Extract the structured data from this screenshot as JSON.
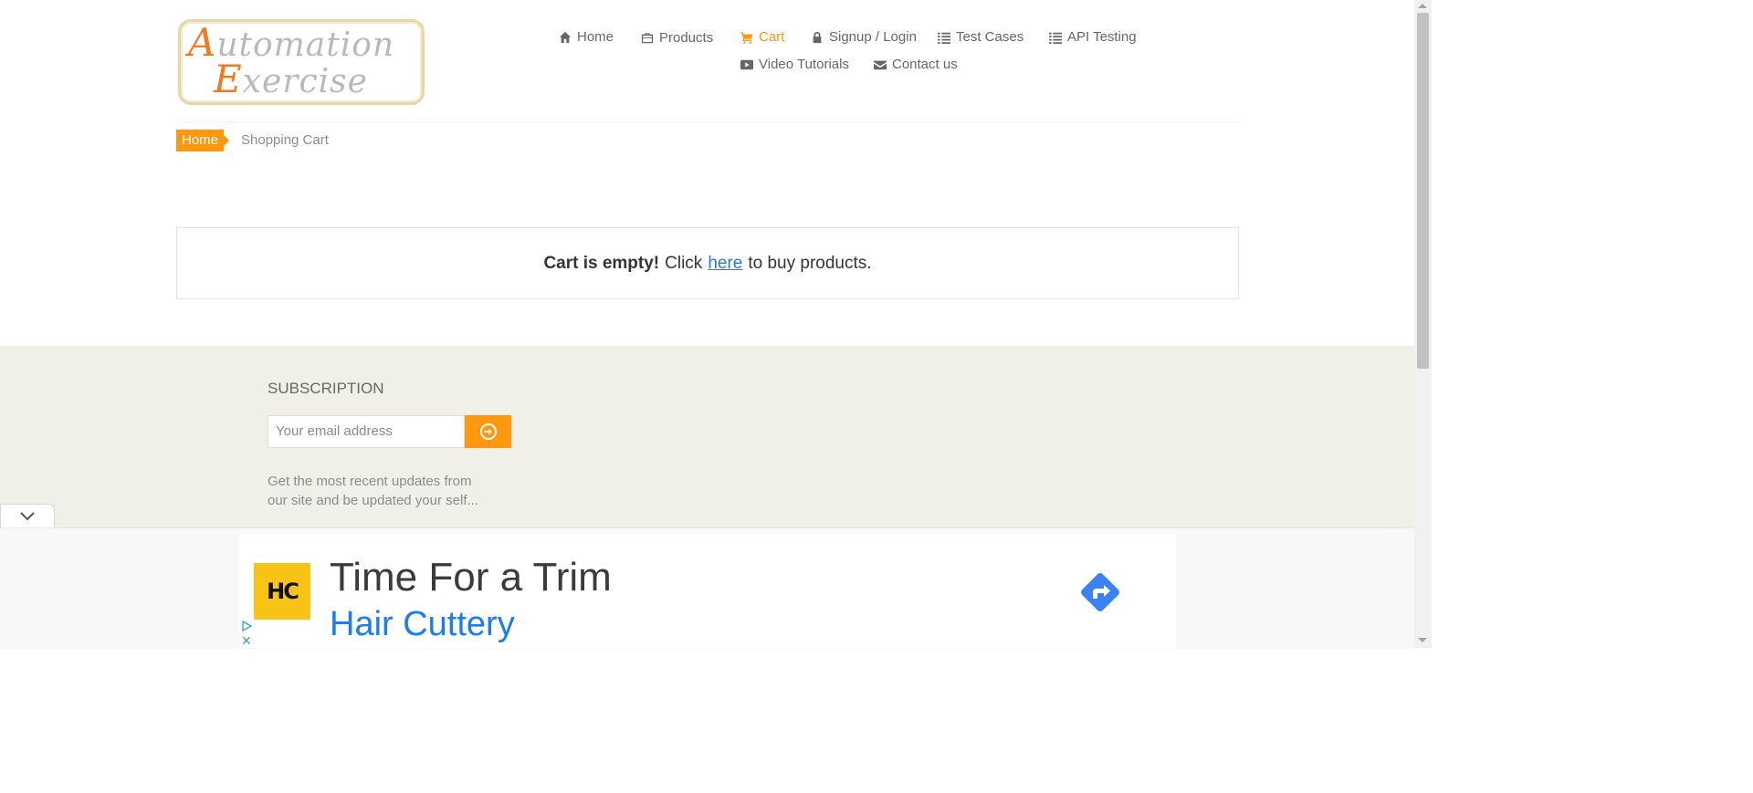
{
  "logo": {
    "line1_cap": "A",
    "line1_rest": "utomation",
    "line2_cap": "E",
    "line2_rest": "xercise"
  },
  "nav": {
    "home": "Home",
    "products": "Products",
    "cart": "Cart",
    "signup": "Signup / Login",
    "test_cases": "Test Cases",
    "api_testing": "API Testing",
    "video_tutorials": "Video Tutorials",
    "contact": "Contact us"
  },
  "breadcrumb": {
    "home": "Home",
    "current": "Shopping Cart"
  },
  "cart": {
    "empty_bold": "Cart is empty!",
    "click": "Click",
    "link": "here",
    "rest": "to buy products."
  },
  "footer": {
    "title": "SUBSCRIPTION",
    "email_placeholder": "Your email address",
    "description": "Get the most recent updates from our site and be updated your self..."
  },
  "ad": {
    "logo_text": "HC",
    "title": "Time For a Trim",
    "brand": "Hair Cuttery"
  },
  "colors": {
    "accent": "#fe980f",
    "link": "#2a7bd6",
    "footer_bg": "#f0f0e9",
    "ad_brand": "#1a7df0"
  }
}
